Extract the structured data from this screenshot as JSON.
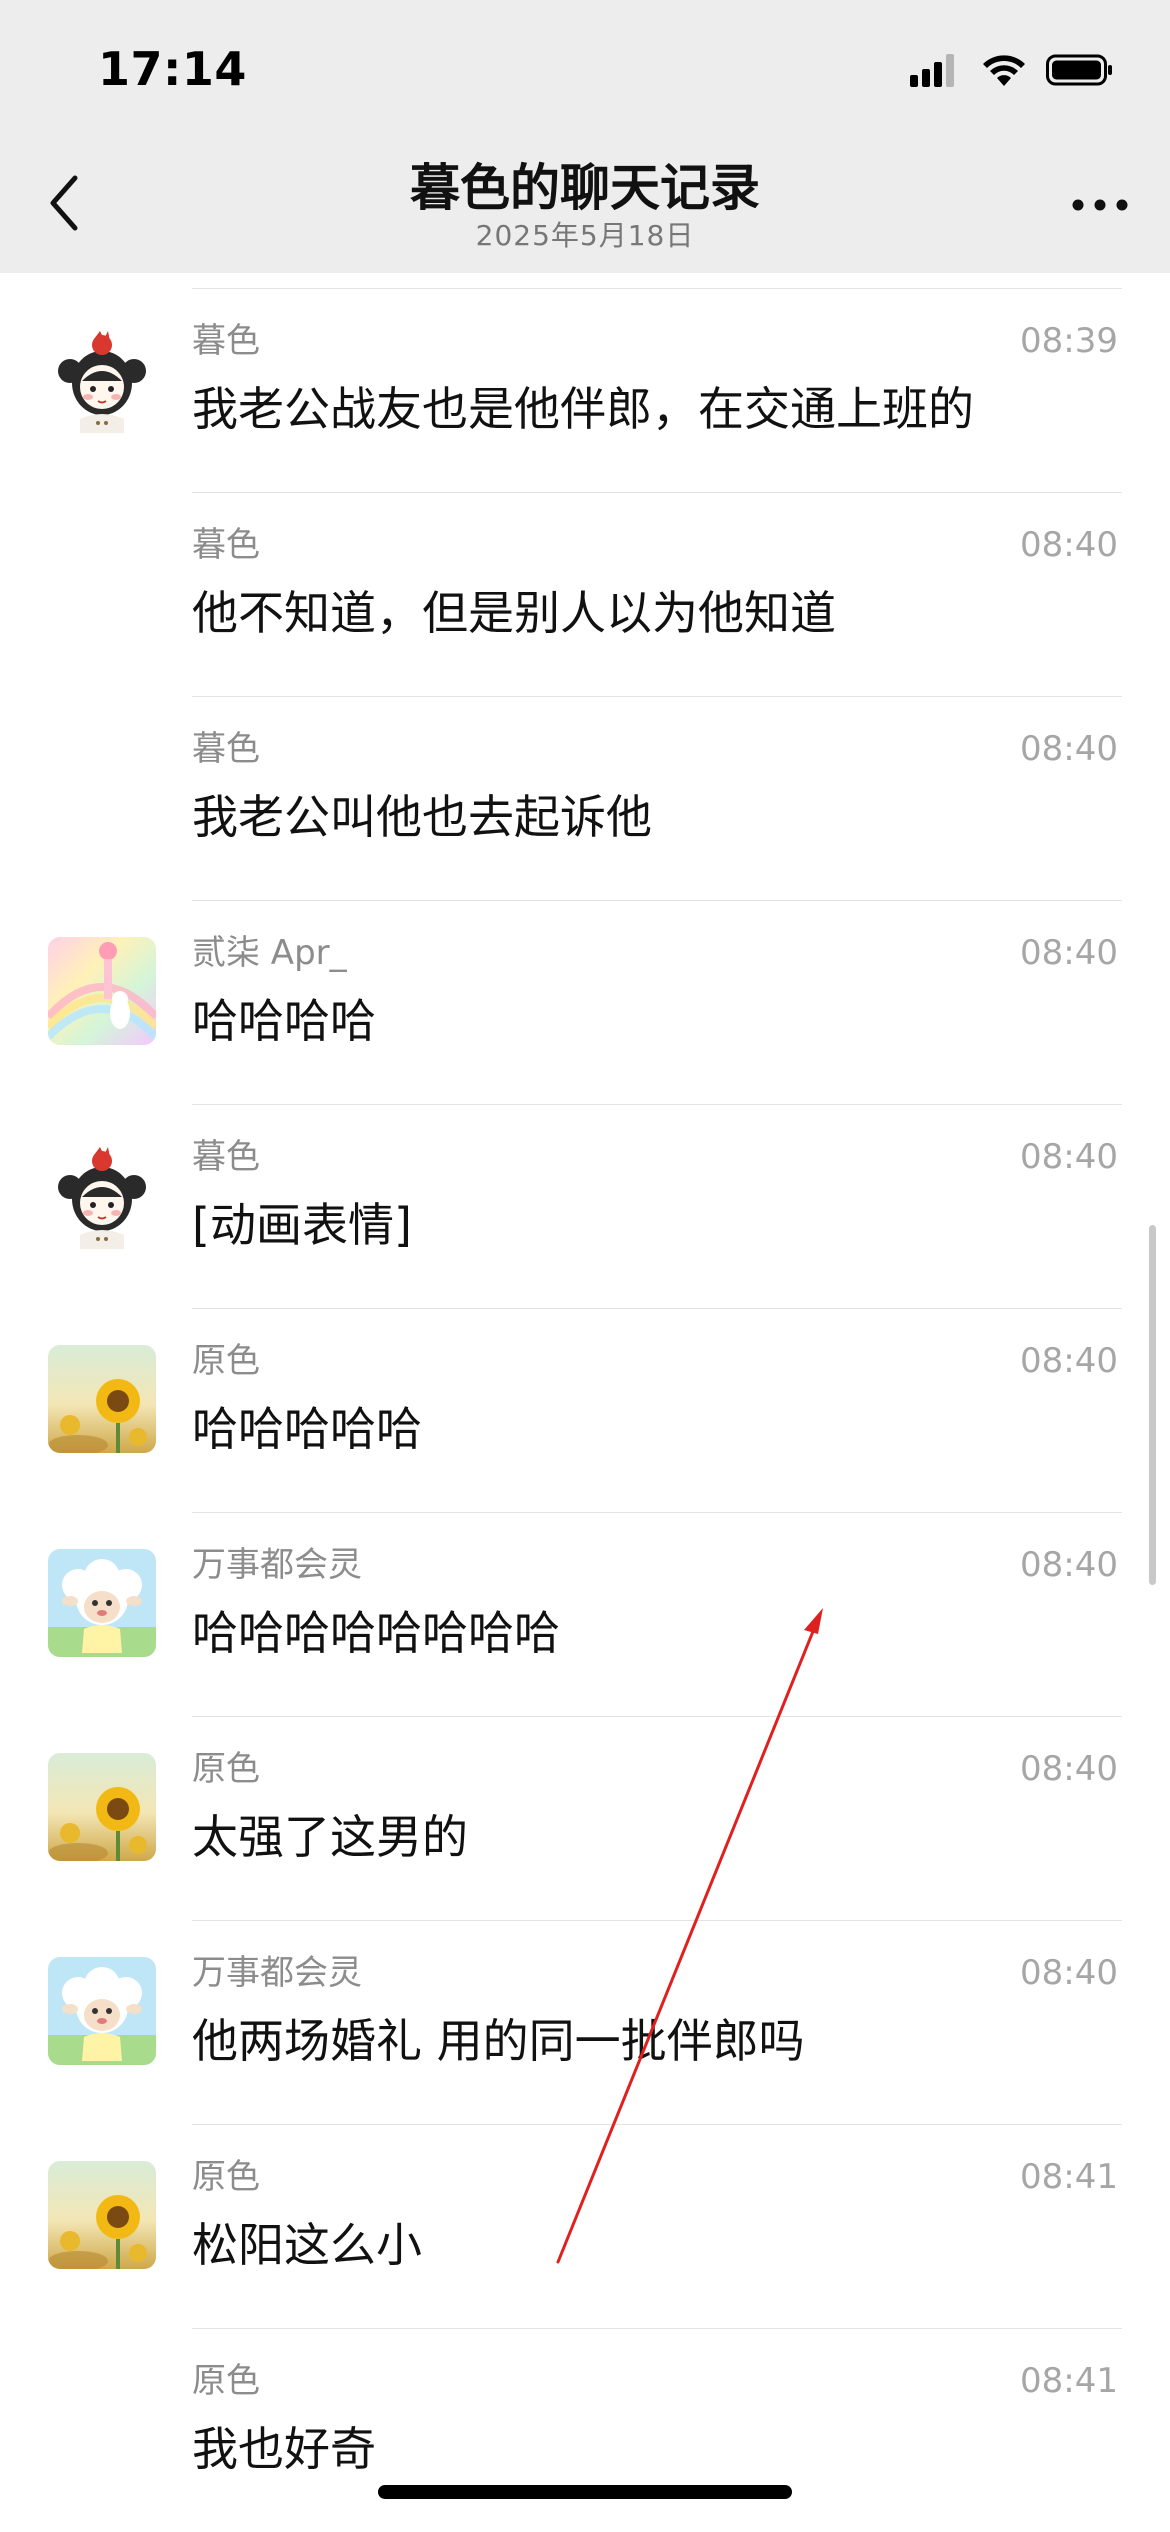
{
  "status_bar": {
    "time": "17:14",
    "icons": [
      "cellular-signal-icon",
      "wifi-icon",
      "battery-icon"
    ]
  },
  "header": {
    "title": "暮色的聊天记录",
    "subtitle": "2025年5月18日",
    "back_icon": "chevron-left-icon",
    "more_icon": "more-dots-icon"
  },
  "messages": [
    {
      "sender": "暮色",
      "time": "08:39",
      "text": "我老公战友也是他伴郎，在交通上班的",
      "avatar": "cartoon-girl-avatar",
      "show_avatar": true
    },
    {
      "sender": "暮色",
      "time": "08:40",
      "text": "他不知道，但是别人以为他知道",
      "avatar": "",
      "show_avatar": false
    },
    {
      "sender": "暮色",
      "time": "08:40",
      "text": "我老公叫他也去起诉他",
      "avatar": "",
      "show_avatar": false
    },
    {
      "sender": "贰柒 Apr_",
      "time": "08:40",
      "text": "哈哈哈哈",
      "avatar": "pastel-rainbow-avatar",
      "show_avatar": true
    },
    {
      "sender": "暮色",
      "time": "08:40",
      "text": "[动画表情]",
      "avatar": "cartoon-girl-avatar",
      "show_avatar": true
    },
    {
      "sender": "原色",
      "time": "08:40",
      "text": "哈哈哈哈哈",
      "avatar": "sunflower-avatar",
      "show_avatar": true
    },
    {
      "sender": "万事都会灵",
      "time": "08:40",
      "text": "哈哈哈哈哈哈哈哈",
      "avatar": "cartoon-sheep-avatar",
      "show_avatar": true
    },
    {
      "sender": "原色",
      "time": "08:40",
      "text": "太强了这男的",
      "avatar": "sunflower-avatar",
      "show_avatar": true
    },
    {
      "sender": "万事都会灵",
      "time": "08:40",
      "text": "他两场婚礼 用的同一批伴郎吗",
      "avatar": "cartoon-sheep-avatar",
      "show_avatar": true
    },
    {
      "sender": "原色",
      "time": "08:41",
      "text": "松阳这么小",
      "avatar": "sunflower-avatar",
      "show_avatar": true
    },
    {
      "sender": "原色",
      "time": "08:41",
      "text": "我也好奇",
      "avatar": "",
      "show_avatar": false
    }
  ],
  "colors": {
    "header_bg": "#ededed",
    "annotation_arrow": "#e02020",
    "secondary_text": "#8c8c8c"
  }
}
